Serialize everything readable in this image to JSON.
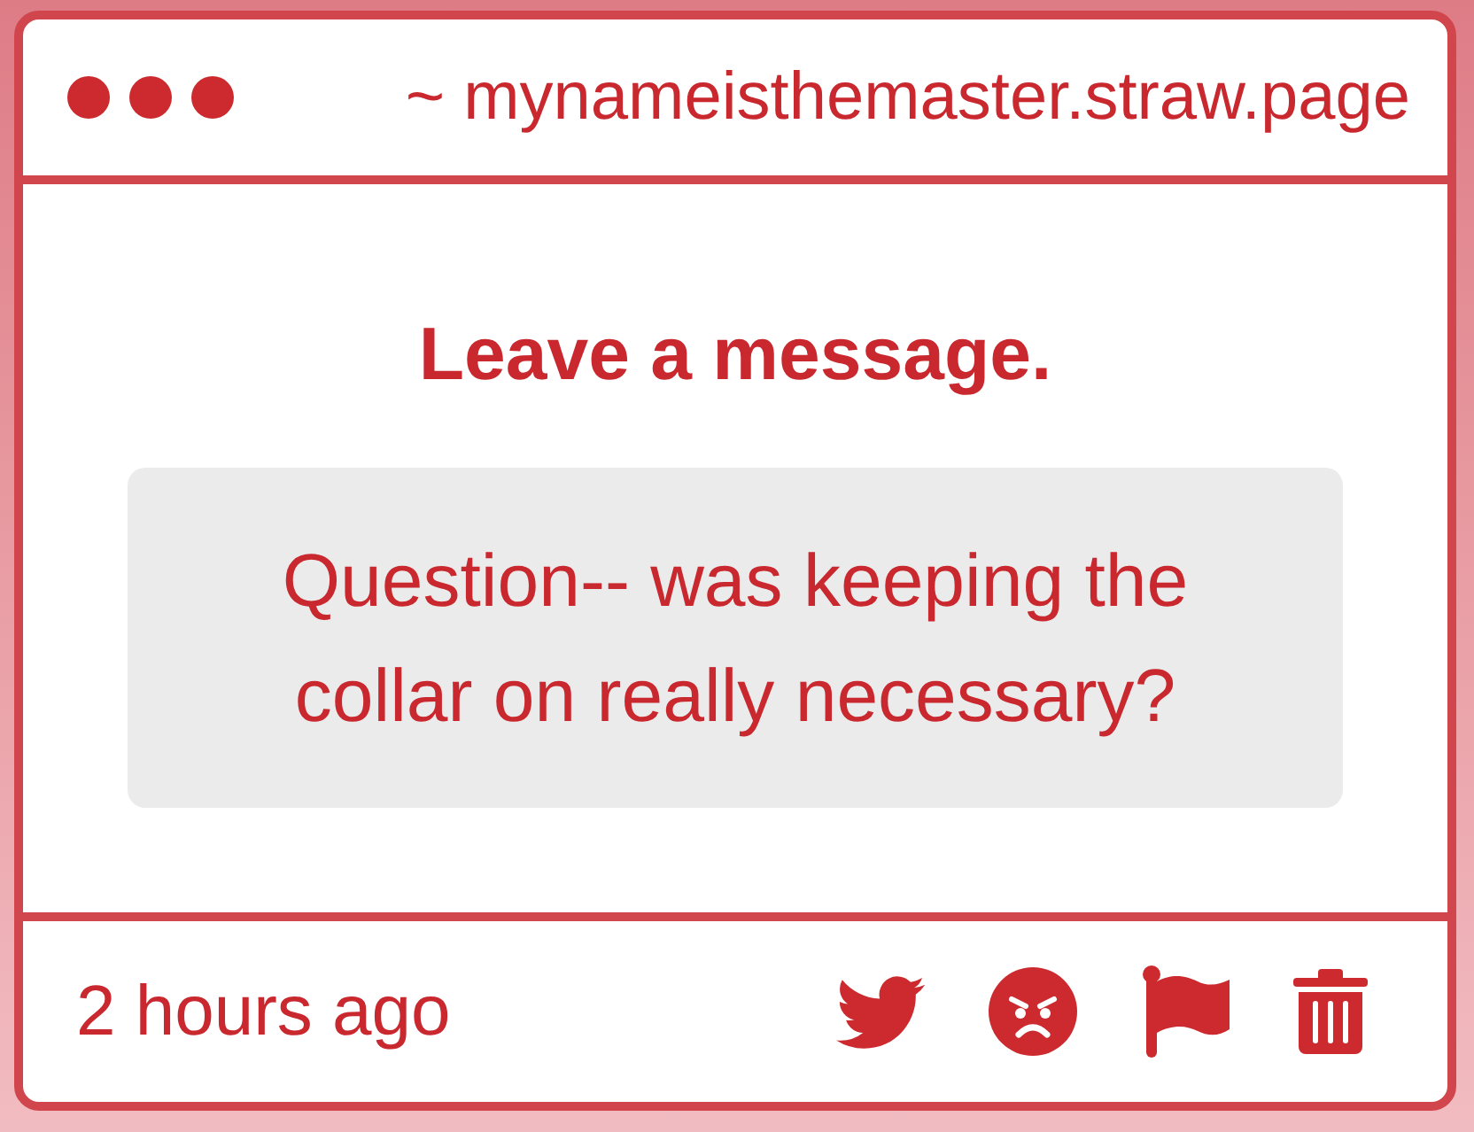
{
  "window": {
    "address": "~ mynameisthemaster.straw.page"
  },
  "prompt": {
    "heading": "Leave a message."
  },
  "message": {
    "text": "Question-- was keeping the collar on really necessary?"
  },
  "footer": {
    "time": "2 hours ago"
  }
}
